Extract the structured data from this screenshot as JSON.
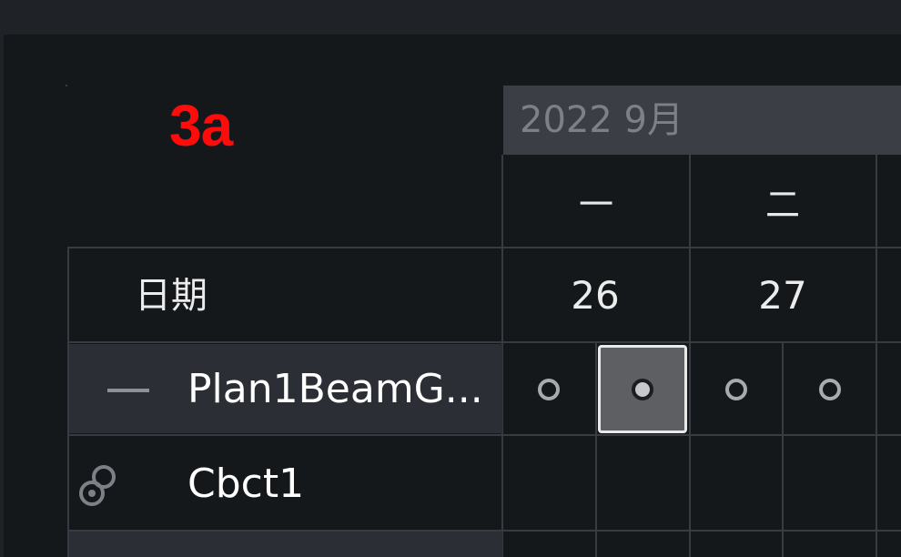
{
  "annotation": {
    "step": "3a",
    "color": "#ff0b0b"
  },
  "calendar": {
    "month_header": "2022 9月",
    "weekdays": [
      "一",
      "二"
    ],
    "date_column_label": "日期",
    "day_numbers": [
      "26",
      "27"
    ]
  },
  "rows": [
    {
      "label": "Plan1BeamG...",
      "icon": "collapse-minus-icon"
    },
    {
      "label": "Cbct1",
      "icon": "link-icon"
    }
  ],
  "selected_cell": {
    "row": 0,
    "column": 1
  },
  "colors": {
    "background": "#15181b",
    "header_bar": "#3b3e44",
    "row_highlight": "#2b2e34",
    "selected_cell": "#5d5f62",
    "grid_line": "#383c42"
  }
}
